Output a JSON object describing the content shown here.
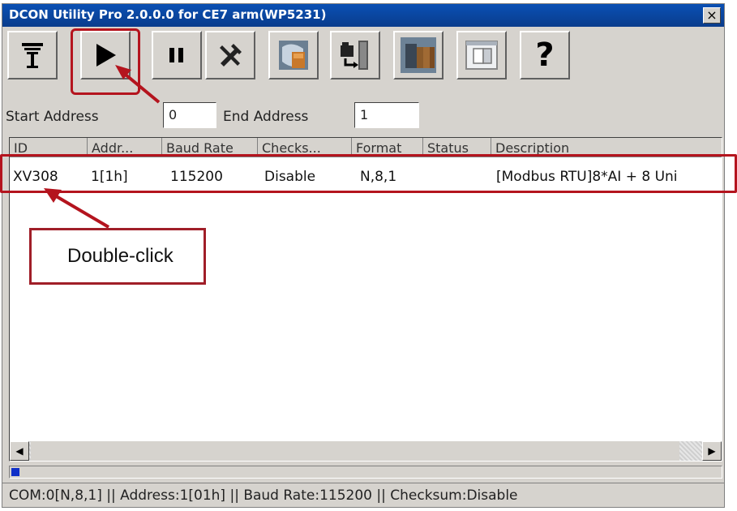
{
  "window": {
    "title": "DCON Utility Pro 2.0.0.0 for CE7 arm(WP5231)",
    "close_glyph": "×"
  },
  "toolbar": {
    "buttons": [
      {
        "icon": "com-port-icon"
      },
      {
        "icon": "play-icon"
      },
      {
        "icon": "pause-icon"
      },
      {
        "icon": "tools-icon"
      },
      {
        "icon": "module-config-icon"
      },
      {
        "icon": "transfer-icon"
      },
      {
        "icon": "module-rack-icon"
      },
      {
        "icon": "document-window-icon"
      },
      {
        "icon": "help-icon",
        "glyph": "?"
      }
    ]
  },
  "address": {
    "start_label": "Start Address",
    "start_value": "0",
    "end_label": "End Address",
    "end_value": "1"
  },
  "table": {
    "columns": [
      "ID",
      "Addr...",
      "Baud Rate",
      "Checks...",
      "Format",
      "Status",
      "Description"
    ],
    "rows": [
      {
        "id": "XV308",
        "addr": "1[1h]",
        "baud": "115200",
        "checksum": "Disable",
        "format": "N,8,1",
        "status": "",
        "description": "[Modbus RTU]8*AI + 8 Uni"
      }
    ]
  },
  "scrollbar": {
    "left_glyph": "◀",
    "right_glyph": "▶"
  },
  "progress": {
    "fraction": 0.006
  },
  "status_bar": {
    "text": "COM:0[N,8,1] || Address:1[01h] || Baud Rate:115200 || Checksum:Disable"
  },
  "annotation": {
    "callout_text": "Double-click",
    "color": "#b4141e"
  }
}
